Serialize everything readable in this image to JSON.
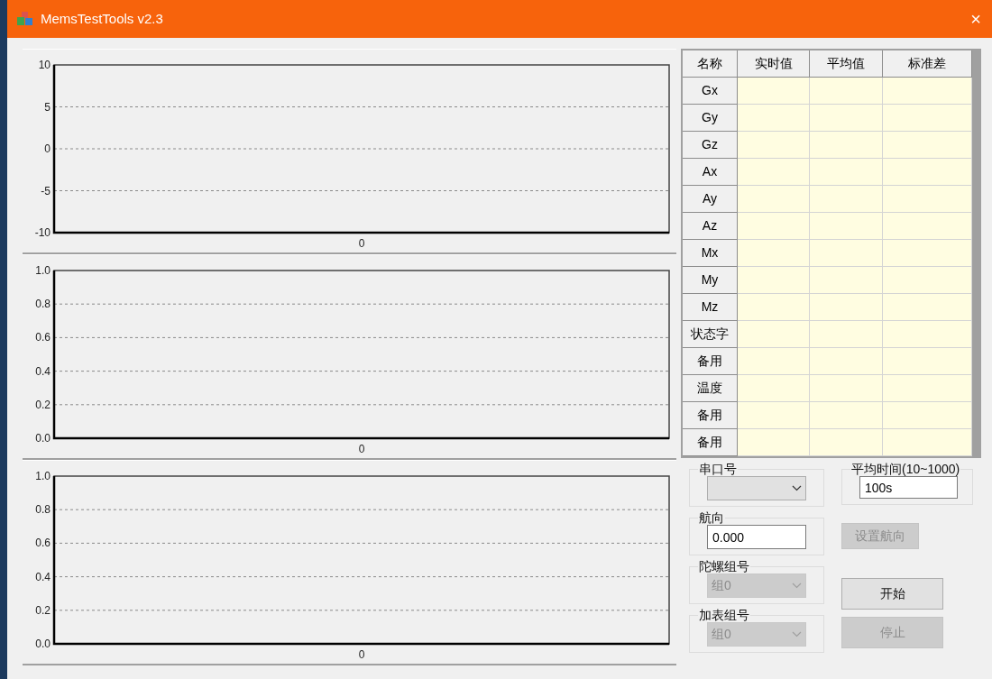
{
  "window": {
    "title": "MemsTestTools v2.3",
    "close": "×"
  },
  "charts": [
    {
      "chart_data": {
        "type": "line",
        "grid": true,
        "categories": [
          "0"
        ],
        "ylim": [
          -10,
          10
        ],
        "yticks": [
          {
            "value": -10,
            "label": "-10"
          },
          {
            "value": -5,
            "label": "-5"
          },
          {
            "value": 0,
            "label": "0"
          },
          {
            "value": 5,
            "label": "5"
          },
          {
            "value": 10,
            "label": "10"
          }
        ]
      }
    },
    {
      "chart_data": {
        "type": "line",
        "grid": true,
        "categories": [
          "0"
        ],
        "ylim": [
          0,
          1
        ],
        "yticks": [
          {
            "value": 0,
            "label": "0.0"
          },
          {
            "value": 0.2,
            "label": "0.2"
          },
          {
            "value": 0.4,
            "label": "0.4"
          },
          {
            "value": 0.6,
            "label": "0.6"
          },
          {
            "value": 0.8,
            "label": "0.8"
          },
          {
            "value": 1,
            "label": "1.0"
          }
        ]
      }
    },
    {
      "chart_data": {
        "type": "line",
        "grid": true,
        "categories": [
          "0"
        ],
        "ylim": [
          0,
          1
        ],
        "yticks": [
          {
            "value": 0,
            "label": "0.0"
          },
          {
            "value": 0.2,
            "label": "0.2"
          },
          {
            "value": 0.4,
            "label": "0.4"
          },
          {
            "value": 0.6,
            "label": "0.6"
          },
          {
            "value": 0.8,
            "label": "0.8"
          },
          {
            "value": 1,
            "label": "1.0"
          }
        ]
      }
    }
  ],
  "table": {
    "columns": [
      "名称",
      "实时值",
      "平均值",
      "标准差"
    ],
    "rows": [
      {
        "name": "Gx"
      },
      {
        "name": "Gy"
      },
      {
        "name": "Gz"
      },
      {
        "name": "Ax"
      },
      {
        "name": "Ay"
      },
      {
        "name": "Az"
      },
      {
        "name": "Mx"
      },
      {
        "name": "My"
      },
      {
        "name": "Mz"
      },
      {
        "name": "状态字"
      },
      {
        "name": "备用"
      },
      {
        "name": "温度"
      },
      {
        "name": "备用"
      },
      {
        "name": "备用"
      }
    ]
  },
  "serial_port": {
    "label": "串口号",
    "disabled": false
  },
  "average_time": {
    "label": "平均时间(10~1000)",
    "value": "100s"
  },
  "heading": {
    "label": "航向",
    "value": "0.000"
  },
  "set_heading_button": {
    "label": "设置航向",
    "disabled": true
  },
  "gyro_group": {
    "label": "陀螺组号",
    "value": "组0",
    "disabled": true
  },
  "start_button": {
    "label": "开始",
    "disabled": false
  },
  "accel_group": {
    "label": "加表组号",
    "value": "组0",
    "disabled": true
  },
  "stop_button": {
    "label": "停止",
    "disabled": true
  }
}
